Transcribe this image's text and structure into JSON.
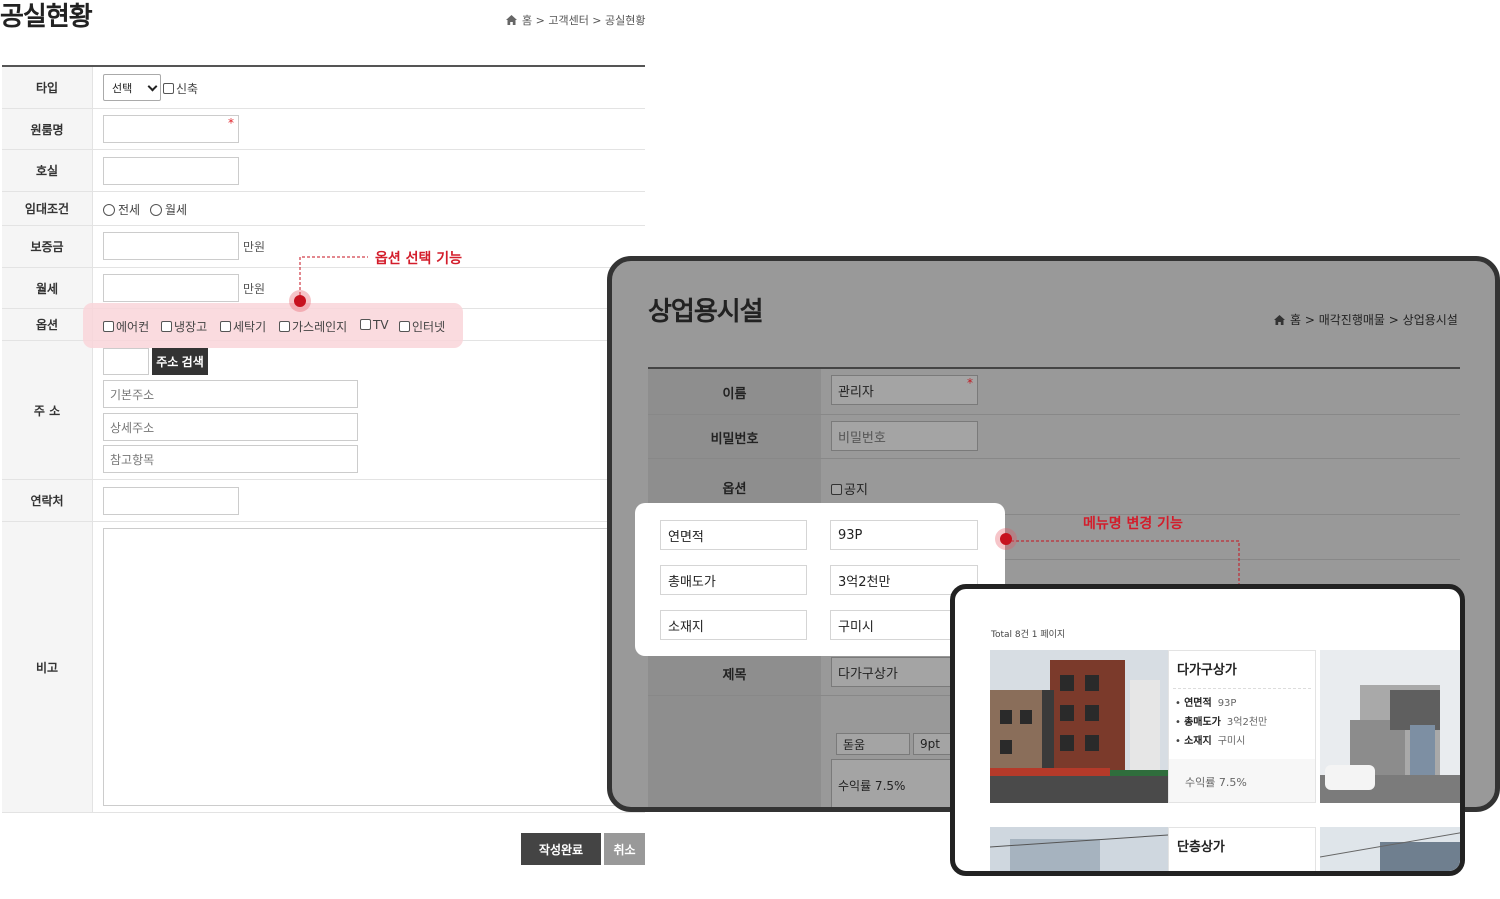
{
  "form": {
    "title": "공실현황",
    "breadcrumb": "홈 > 고객센터 > 공실현황",
    "labels": {
      "type": "타입",
      "room_name": "원룸명",
      "unit": "호실",
      "lease": "임대조건",
      "deposit": "보증금",
      "monthly": "월세",
      "options": "옵션",
      "address": "주 소",
      "contact": "연락처",
      "remarks": "비고"
    },
    "type_select": "선택",
    "new_build": "신축",
    "lease_options": [
      "전세",
      "월세"
    ],
    "unit_label": "만원",
    "option_items": [
      "에어컨",
      "냉장고",
      "세탁기",
      "가스레인지",
      "TV",
      "인터넷"
    ],
    "address_search_button": "주소 검색",
    "address_placeholders": [
      "기본주소",
      "상세주소",
      "참고항목"
    ],
    "submit_button": "작성완료",
    "cancel_button": "취소",
    "required_mark": "*"
  },
  "annotations": {
    "option_note": "옵션 선택 기능",
    "menu_note": "메뉴명 변경 기능",
    "highlight_color": "#d31d2b"
  },
  "commercial": {
    "title": "상업용시설",
    "breadcrumb": "홈 > 매각진행매물 > 상업용시설",
    "labels": {
      "name": "이름",
      "password": "비밀번호",
      "option": "옵션",
      "subject": "제목"
    },
    "name_value": "관리자",
    "password_placeholder": "비밀번호",
    "notice_checkbox": "공지",
    "subject_value": "다가구상가",
    "editor_font": "돋움",
    "editor_size": "9pt",
    "editor_content": "수익률 7.5%",
    "fields": [
      {
        "label": "연면적",
        "value": "93P"
      },
      {
        "label": "총매도가",
        "value": "3억2천만"
      },
      {
        "label": "소재지",
        "value": "구미시"
      }
    ]
  },
  "listing": {
    "total": "Total 8건 1 페이지",
    "items": [
      {
        "title": "다가구상가",
        "specs": [
          {
            "key": "연면적",
            "value": "93P"
          },
          {
            "key": "총매도가",
            "value": "3억2천만"
          },
          {
            "key": "소재지",
            "value": "구미시"
          }
        ],
        "yield": "수익률 7.5%"
      },
      {
        "title": "단층상가"
      }
    ]
  }
}
